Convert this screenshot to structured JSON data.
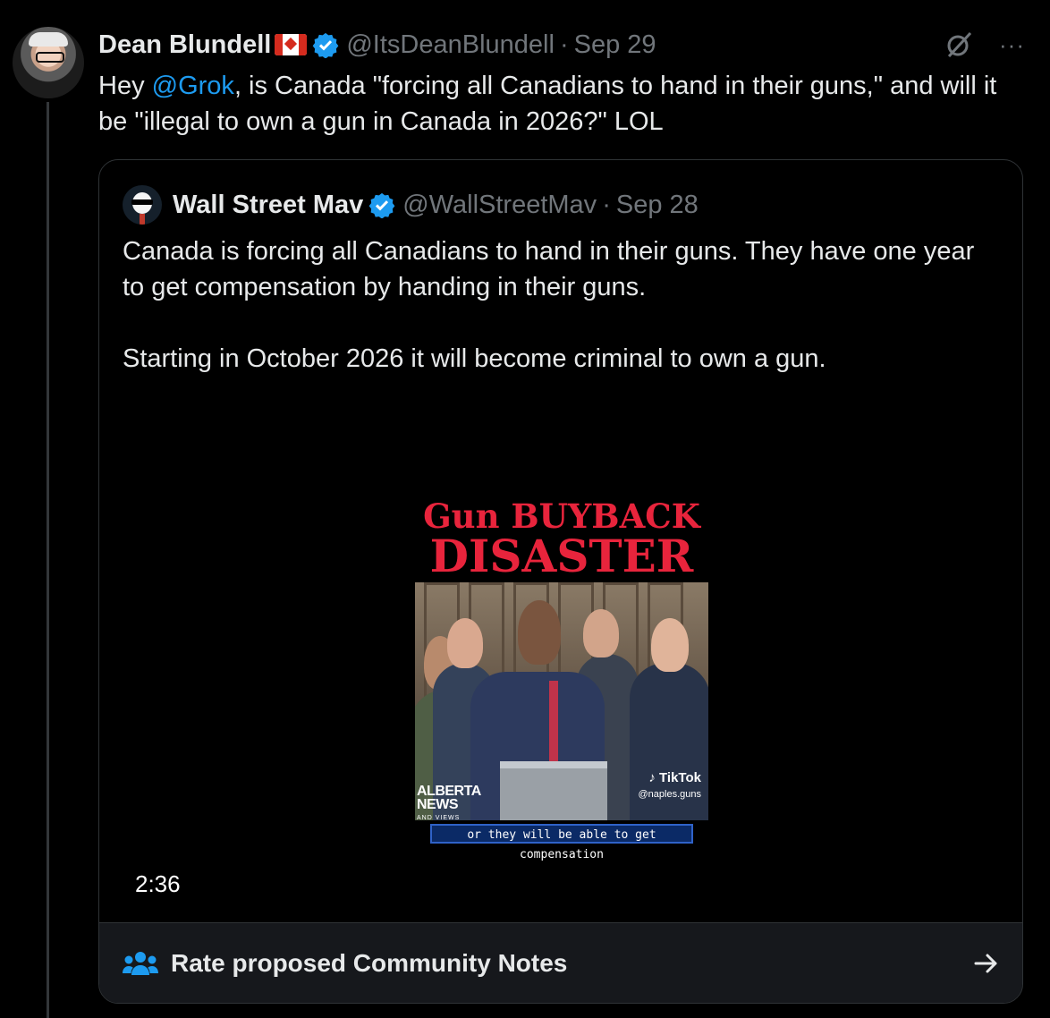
{
  "tweet": {
    "author_name": "Dean Blundell",
    "author_flag": "🇨🇦",
    "handle": "@ItsDeanBlundell",
    "separator": "·",
    "date": "Sep 29",
    "text_prefix": "Hey ",
    "mention": "@Grok",
    "text_suffix": ", is Canada \"forcing all Canadians to hand in their guns,\" and will it be \"illegal to own a gun in Canada in 2026?\" LOL",
    "icons": [
      "grok-icon",
      "more-icon"
    ],
    "more_label": "···"
  },
  "quoted": {
    "author_name": "Wall Street Mav",
    "handle": "@WallStreetMav",
    "separator": "·",
    "date": "Sep 28",
    "paragraph1": "Canada is forcing all Canadians to hand in their guns. They have one year to get compensation by handing in their guns.",
    "paragraph2": "Starting in October 2026 it will become criminal to own a gun.",
    "video": {
      "title_line1": "Gun BUYBACK",
      "title_line2": "DISASTER",
      "caption": "or they will be able to get compensation",
      "watermark_brand": "TikTok",
      "watermark_handle": "@naples.guns",
      "logo_line1": "ALBERTA",
      "logo_line2": "NEWS",
      "logo_line3": "AND VIEWS",
      "duration": "2:36"
    }
  },
  "community_notes": {
    "label": "Rate proposed Community Notes",
    "icon": "people-icon",
    "arrow_icon": "arrow-right-icon"
  },
  "colors": {
    "background": "#000000",
    "text": "#e7e9ea",
    "muted": "#71767b",
    "accent": "#1d9bf0",
    "title_red": "#e8243c"
  }
}
